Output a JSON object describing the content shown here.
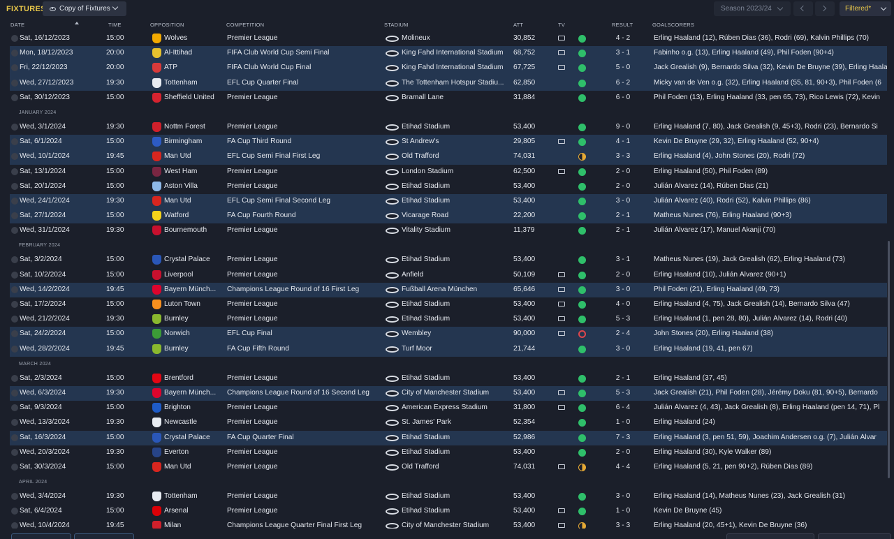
{
  "topbar": {
    "title": "FIXTURES",
    "view_select": "Copy of Fixtures",
    "season_select": "Season 2023/24",
    "filter_button": "Filtered*"
  },
  "columns": {
    "date": "DATE",
    "time": "TIME",
    "opposition": "OPPOSITION",
    "competition": "COMPETITION",
    "stadium": "STADIUM",
    "att": "ATT",
    "tv": "TV",
    "result": "RESULT",
    "goalscorers": "GOALSCORERS"
  },
  "colors": {
    "accent": "#e8c74a",
    "highlight_row": "#243650",
    "win": "#2fbf6a",
    "draw": "#e6a935",
    "loss": "#e0464c"
  },
  "rows": [
    {
      "kind": "match",
      "hl": false,
      "date": "Sat, 16/12/2023",
      "time": "15:00",
      "opp": "Wolves",
      "badge": "#f2a900",
      "comp": "Premier League",
      "stadium": "Molineux",
      "att": "30,852",
      "tv": true,
      "res": "W",
      "score": "4 - 2",
      "scorers": "Erling Haaland (12), Rúben Dias (36), Rodri (69), Kalvin Phillips (70)"
    },
    {
      "kind": "match",
      "hl": true,
      "date": "Mon, 18/12/2023",
      "time": "20:00",
      "opp": "Al-Ittihad",
      "badge": "#e6c12e",
      "comp": "FIFA Club World Cup Semi Final",
      "stadium": "King Fahd International Stadium",
      "att": "68,752",
      "tv": true,
      "res": "W",
      "score": "3 - 1",
      "scorers": "Fabinho o.g. (13), Erling Haaland (49), Phil Foden (90+4)"
    },
    {
      "kind": "match",
      "hl": true,
      "date": "Fri, 22/12/2023",
      "time": "20:00",
      "opp": "ATP",
      "badge": "#d93a3a",
      "comp": "FIFA Club World Cup Final",
      "stadium": "King Fahd International Stadium",
      "att": "67,725",
      "tv": true,
      "res": "W",
      "score": "5 - 0",
      "scorers": "Jack Grealish (9), Bernardo Silva (32), Kevin De Bruyne (39), Erling Haaland"
    },
    {
      "kind": "match",
      "hl": true,
      "date": "Wed, 27/12/2023",
      "time": "19:30",
      "opp": "Tottenham",
      "badge": "#e8ecf2",
      "comp": "EFL Cup Quarter Final",
      "stadium": "The Tottenham Hotspur Stadiu...",
      "att": "62,850",
      "tv": false,
      "res": "W",
      "score": "6 - 2",
      "scorers": "Micky van de Ven o.g. (32), Erling Haaland (55, 81, 90+3), Phil Foden (6"
    },
    {
      "kind": "match",
      "hl": false,
      "date": "Sat, 30/12/2023",
      "time": "15:00",
      "opp": "Sheffield United",
      "badge": "#d6232f",
      "comp": "Premier League",
      "stadium": "Bramall Lane",
      "att": "31,884",
      "tv": false,
      "res": "W",
      "score": "6 - 0",
      "scorers": "Phil Foden (13), Erling Haaland (33, pen 65, 73), Rico Lewis (72), Kevin"
    },
    {
      "kind": "month",
      "label": "JANUARY 2024"
    },
    {
      "kind": "match",
      "hl": false,
      "date": "Wed, 3/1/2024",
      "time": "19:30",
      "opp": "Nottm Forest",
      "badge": "#d0202b",
      "comp": "Premier League",
      "stadium": "Etihad Stadium",
      "att": "53,400",
      "tv": false,
      "res": "W",
      "score": "9 - 0",
      "scorers": "Erling Haaland (7, 80), Jack Grealish (9, 45+3), Rodri (23), Bernardo Si"
    },
    {
      "kind": "match",
      "hl": true,
      "date": "Sat, 6/1/2024",
      "time": "15:00",
      "opp": "Birmingham",
      "badge": "#2d5bc4",
      "comp": "FA Cup Third Round",
      "stadium": "St Andrew's",
      "att": "29,805",
      "tv": true,
      "res": "W",
      "score": "4 - 1",
      "scorers": "Kevin De Bruyne (29, 32), Erling Haaland (52, 90+4)"
    },
    {
      "kind": "match",
      "hl": true,
      "date": "Wed, 10/1/2024",
      "time": "19:45",
      "opp": "Man Utd",
      "badge": "#d8261f",
      "comp": "EFL Cup Semi Final First Leg",
      "stadium": "Old Trafford",
      "att": "74,031",
      "tv": false,
      "res": "D",
      "score": "3 - 3",
      "scorers": "Erling Haaland (4), John Stones (20), Rodri (72)"
    },
    {
      "kind": "match",
      "hl": false,
      "date": "Sat, 13/1/2024",
      "time": "15:00",
      "opp": "West Ham",
      "badge": "#7a2642",
      "comp": "Premier League",
      "stadium": "London Stadium",
      "att": "62,500",
      "tv": true,
      "res": "W",
      "score": "2 - 0",
      "scorers": "Erling Haaland (50), Phil Foden (89)"
    },
    {
      "kind": "match",
      "hl": false,
      "date": "Sat, 20/1/2024",
      "time": "15:00",
      "opp": "Aston Villa",
      "badge": "#8fb9e8",
      "comp": "Premier League",
      "stadium": "Etihad Stadium",
      "att": "53,400",
      "tv": false,
      "res": "W",
      "score": "2 - 0",
      "scorers": "Julián Álvarez (14), Rúben Dias (21)"
    },
    {
      "kind": "match",
      "hl": true,
      "date": "Wed, 24/1/2024",
      "time": "19:30",
      "opp": "Man Utd",
      "badge": "#d8261f",
      "comp": "EFL Cup Semi Final Second Leg",
      "stadium": "Etihad Stadium",
      "att": "53,400",
      "tv": false,
      "res": "W",
      "score": "3 - 0",
      "scorers": "Julián Álvarez (40), Rodri (52), Kalvin Phillips (86)"
    },
    {
      "kind": "match",
      "hl": true,
      "date": "Sat, 27/1/2024",
      "time": "15:00",
      "opp": "Watford",
      "badge": "#f4d21b",
      "comp": "FA Cup Fourth Round",
      "stadium": "Vicarage Road",
      "att": "22,200",
      "tv": false,
      "res": "W",
      "score": "2 - 1",
      "scorers": "Matheus Nunes (76), Erling Haaland (90+3)"
    },
    {
      "kind": "match",
      "hl": false,
      "date": "Wed, 31/1/2024",
      "time": "19:30",
      "opp": "Bournemouth",
      "badge": "#c8102e",
      "comp": "Premier League",
      "stadium": "Vitality Stadium",
      "att": "11,379",
      "tv": false,
      "res": "W",
      "score": "2 - 1",
      "scorers": "Julián Álvarez (17), Manuel Akanji (70)"
    },
    {
      "kind": "month",
      "label": "FEBRUARY 2024"
    },
    {
      "kind": "match",
      "hl": false,
      "date": "Sat, 3/2/2024",
      "time": "15:00",
      "opp": "Crystal Palace",
      "badge": "#2a57b8",
      "comp": "Premier League",
      "stadium": "Etihad Stadium",
      "att": "53,400",
      "tv": false,
      "res": "W",
      "score": "3 - 1",
      "scorers": "Matheus Nunes (19), Jack Grealish (62), Erling Haaland (73)"
    },
    {
      "kind": "match",
      "hl": false,
      "date": "Sat, 10/2/2024",
      "time": "15:00",
      "opp": "Liverpool",
      "badge": "#c8102e",
      "comp": "Premier League",
      "stadium": "Anfield",
      "att": "50,109",
      "tv": true,
      "res": "W",
      "score": "2 - 0",
      "scorers": "Erling Haaland (10), Julián Álvarez (90+1)"
    },
    {
      "kind": "match",
      "hl": true,
      "date": "Wed, 14/2/2024",
      "time": "19:45",
      "opp": "Bayern Münch...",
      "badge": "#dc052d",
      "comp": "Champions League Round of 16  First Leg",
      "stadium": "Fußball Arena München",
      "att": "65,646",
      "tv": true,
      "res": "W",
      "score": "3 - 0",
      "scorers": "Phil Foden (21), Erling Haaland (49, 73)"
    },
    {
      "kind": "match",
      "hl": false,
      "date": "Sat, 17/2/2024",
      "time": "15:00",
      "opp": "Luton Town",
      "badge": "#f78f1e",
      "comp": "Premier League",
      "stadium": "Etihad Stadium",
      "att": "53,400",
      "tv": true,
      "res": "W",
      "score": "4 - 0",
      "scorers": "Erling Haaland (4, 75), Jack Grealish (14), Bernardo Silva (47)"
    },
    {
      "kind": "match",
      "hl": false,
      "date": "Wed, 21/2/2024",
      "time": "19:30",
      "opp": "Burnley",
      "badge": "#8ab82e",
      "comp": "Premier League",
      "stadium": "Etihad Stadium",
      "att": "53,400",
      "tv": true,
      "res": "W",
      "score": "5 - 3",
      "scorers": "Erling Haaland (1, pen 28, 80), Julián Álvarez (14), Rodri (40)"
    },
    {
      "kind": "match",
      "hl": true,
      "date": "Sat, 24/2/2024",
      "time": "15:00",
      "opp": "Norwich",
      "badge": "#3c9c37",
      "comp": "EFL Cup Final",
      "stadium": "Wembley",
      "att": "90,000",
      "tv": true,
      "res": "L",
      "score": "2 - 4",
      "scorers": "John Stones (20), Erling Haaland (38)"
    },
    {
      "kind": "match",
      "hl": true,
      "date": "Wed, 28/2/2024",
      "time": "19:45",
      "opp": "Burnley",
      "badge": "#8ab82e",
      "comp": "FA Cup Fifth Round",
      "stadium": "Turf Moor",
      "att": "21,744",
      "tv": false,
      "res": "W",
      "score": "3 - 0",
      "scorers": "Erling Haaland (19, 41, pen 67)"
    },
    {
      "kind": "month",
      "label": "MARCH 2024"
    },
    {
      "kind": "match",
      "hl": false,
      "date": "Sat, 2/3/2024",
      "time": "15:00",
      "opp": "Brentford",
      "badge": "#e30613",
      "comp": "Premier League",
      "stadium": "Etihad Stadium",
      "att": "53,400",
      "tv": false,
      "res": "W",
      "score": "2 - 1",
      "scorers": "Erling Haaland (37, 45)"
    },
    {
      "kind": "match",
      "hl": true,
      "date": "Wed, 6/3/2024",
      "time": "19:30",
      "opp": "Bayern Münch...",
      "badge": "#dc052d",
      "comp": "Champions League Round of 16  Second Leg",
      "stadium": "City of Manchester Stadium",
      "att": "53,400",
      "tv": true,
      "res": "W",
      "score": "5 - 3",
      "scorers": "Jack Grealish (21), Phil Foden (28), Jérémy Doku (81, 90+5), Bernardo"
    },
    {
      "kind": "match",
      "hl": false,
      "date": "Sat, 9/3/2024",
      "time": "15:00",
      "opp": "Brighton",
      "badge": "#1e5bc6",
      "comp": "Premier League",
      "stadium": "American Express Stadium",
      "att": "31,800",
      "tv": true,
      "res": "W",
      "score": "6 - 4",
      "scorers": "Julián Álvarez (4, 43), Jack Grealish (8), Erling Haaland (pen 14, 71), Pl"
    },
    {
      "kind": "match",
      "hl": false,
      "date": "Wed, 13/3/2024",
      "time": "19:30",
      "opp": "Newcastle",
      "badge": "#e8ecf2",
      "comp": "Premier League",
      "stadium": "St. James' Park",
      "att": "52,354",
      "tv": false,
      "res": "W",
      "score": "1 - 0",
      "scorers": "Erling Haaland (24)"
    },
    {
      "kind": "match",
      "hl": true,
      "date": "Sat, 16/3/2024",
      "time": "15:00",
      "opp": "Crystal Palace",
      "badge": "#2a57b8",
      "comp": "FA Cup Quarter Final",
      "stadium": "Etihad Stadium",
      "att": "52,986",
      "tv": false,
      "res": "W",
      "score": "7 - 3",
      "scorers": "Erling Haaland (3, pen 51, 59), Joachim Andersen o.g. (7), Julián Álvar"
    },
    {
      "kind": "match",
      "hl": false,
      "date": "Wed, 20/3/2024",
      "time": "19:30",
      "opp": "Everton",
      "badge": "#274488",
      "comp": "Premier League",
      "stadium": "Etihad Stadium",
      "att": "53,400",
      "tv": false,
      "res": "W",
      "score": "2 - 0",
      "scorers": "Erling Haaland (30), Kyle Walker (89)"
    },
    {
      "kind": "match",
      "hl": false,
      "date": "Sat, 30/3/2024",
      "time": "15:00",
      "opp": "Man Utd",
      "badge": "#d8261f",
      "comp": "Premier League",
      "stadium": "Old Trafford",
      "att": "74,031",
      "tv": true,
      "res": "D",
      "score": "4 - 4",
      "scorers": "Erling Haaland (5, 21, pen 90+2), Rúben Dias (89)"
    },
    {
      "kind": "month",
      "label": "APRIL 2024"
    },
    {
      "kind": "match",
      "hl": false,
      "date": "Wed, 3/4/2024",
      "time": "19:30",
      "opp": "Tottenham",
      "badge": "#e8ecf2",
      "comp": "Premier League",
      "stadium": "Etihad Stadium",
      "att": "53,400",
      "tv": false,
      "res": "W",
      "score": "3 - 0",
      "scorers": "Erling Haaland (14), Matheus Nunes (23), Jack Grealish (31)"
    },
    {
      "kind": "match",
      "hl": false,
      "date": "Sat, 6/4/2024",
      "time": "15:00",
      "opp": "Arsenal",
      "badge": "#db0007",
      "comp": "Premier League",
      "stadium": "Etihad Stadium",
      "att": "53,400",
      "tv": true,
      "res": "W",
      "score": "1 - 0",
      "scorers": "Kevin De Bruyne (45)"
    },
    {
      "kind": "match",
      "hl": false,
      "date": "Wed, 10/4/2024",
      "time": "19:45",
      "opp": "Milan",
      "badge": "#d0202b",
      "comp": "Champions League Quarter Final First Leg",
      "stadium": "City of Manchester Stadium",
      "att": "53,400",
      "tv": true,
      "res": "D",
      "score": "3 - 3",
      "scorers": "Erling Haaland (20, 45+1), Kevin De Bruyne (36)"
    }
  ]
}
